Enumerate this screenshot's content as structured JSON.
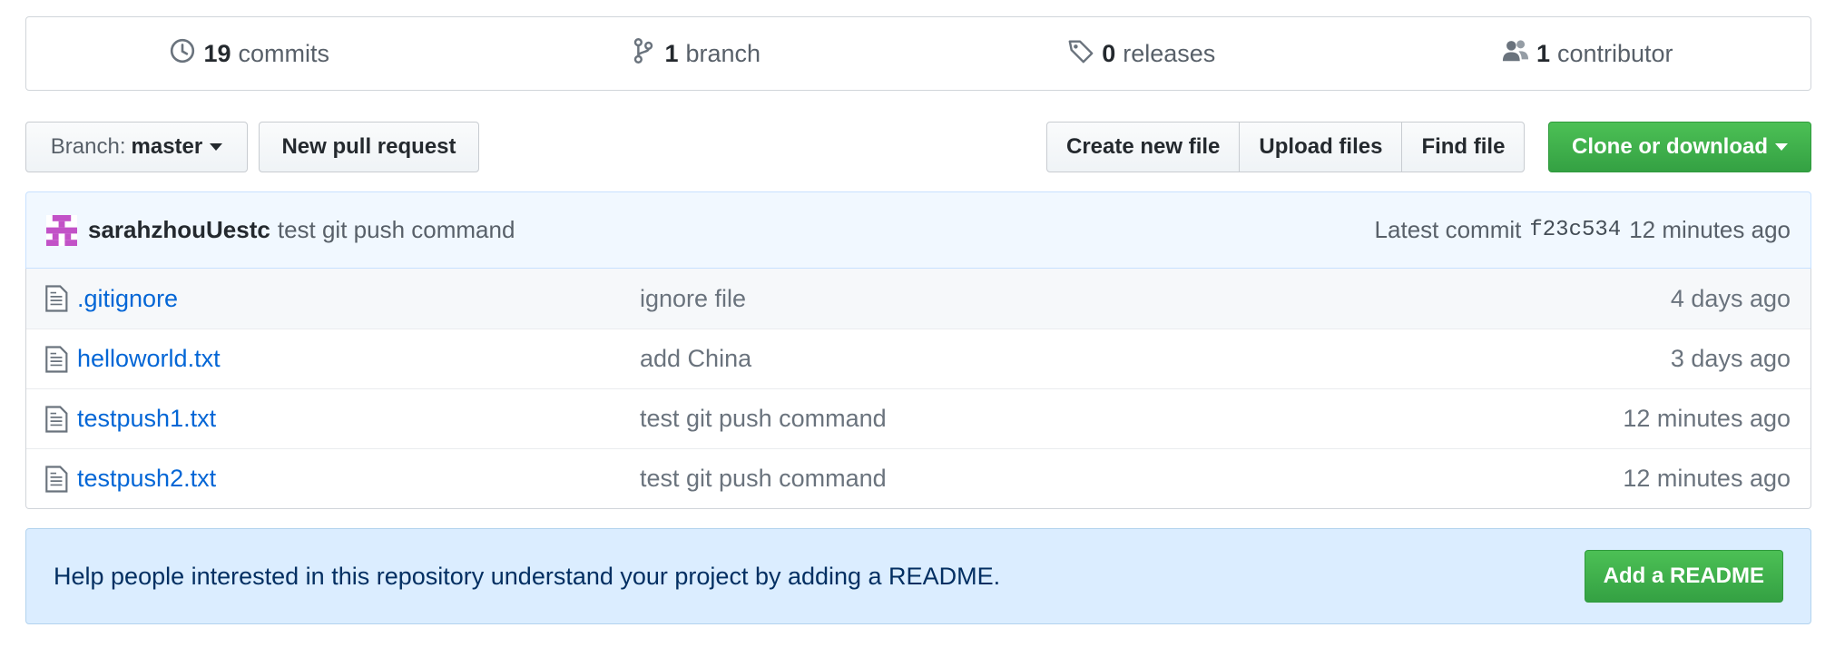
{
  "summary": {
    "commits": {
      "count": "19",
      "label": "commits",
      "icon": "history-icon"
    },
    "branches": {
      "count": "1",
      "label": "branch",
      "icon": "git-branch-icon"
    },
    "releases": {
      "count": "0",
      "label": "releases",
      "icon": "tag-icon"
    },
    "contributors": {
      "count": "1",
      "label": "contributor",
      "icon": "people-icon"
    }
  },
  "toolbar": {
    "branch_prefix": "Branch:",
    "branch_name": "master",
    "new_pr": "New pull request",
    "create_file": "Create new file",
    "upload_files": "Upload files",
    "find_file": "Find file",
    "clone": "Clone or download"
  },
  "latest_commit": {
    "author": "sarahzhouUestc",
    "message": "test git push command",
    "prefix": "Latest commit",
    "sha": "f23c534",
    "age": "12 minutes ago"
  },
  "files": [
    {
      "name": ".gitignore",
      "message": "ignore file",
      "age": "4 days ago",
      "icon": "file-icon"
    },
    {
      "name": "helloworld.txt",
      "message": "add China",
      "age": "3 days ago",
      "icon": "file-icon"
    },
    {
      "name": "testpush1.txt",
      "message": "test git push command",
      "age": "12 minutes ago",
      "icon": "file-icon"
    },
    {
      "name": "testpush2.txt",
      "message": "test git push command",
      "age": "12 minutes ago",
      "icon": "file-icon"
    }
  ],
  "readme_prompt": {
    "text": "Help people interested in this repository understand your project by adding a README.",
    "button": "Add a README"
  },
  "colors": {
    "link": "#0366d6",
    "green_button": "#34a143",
    "tease_bg": "#f1f8ff",
    "readme_bg": "#dbedff",
    "avatar": "#c252c7"
  }
}
